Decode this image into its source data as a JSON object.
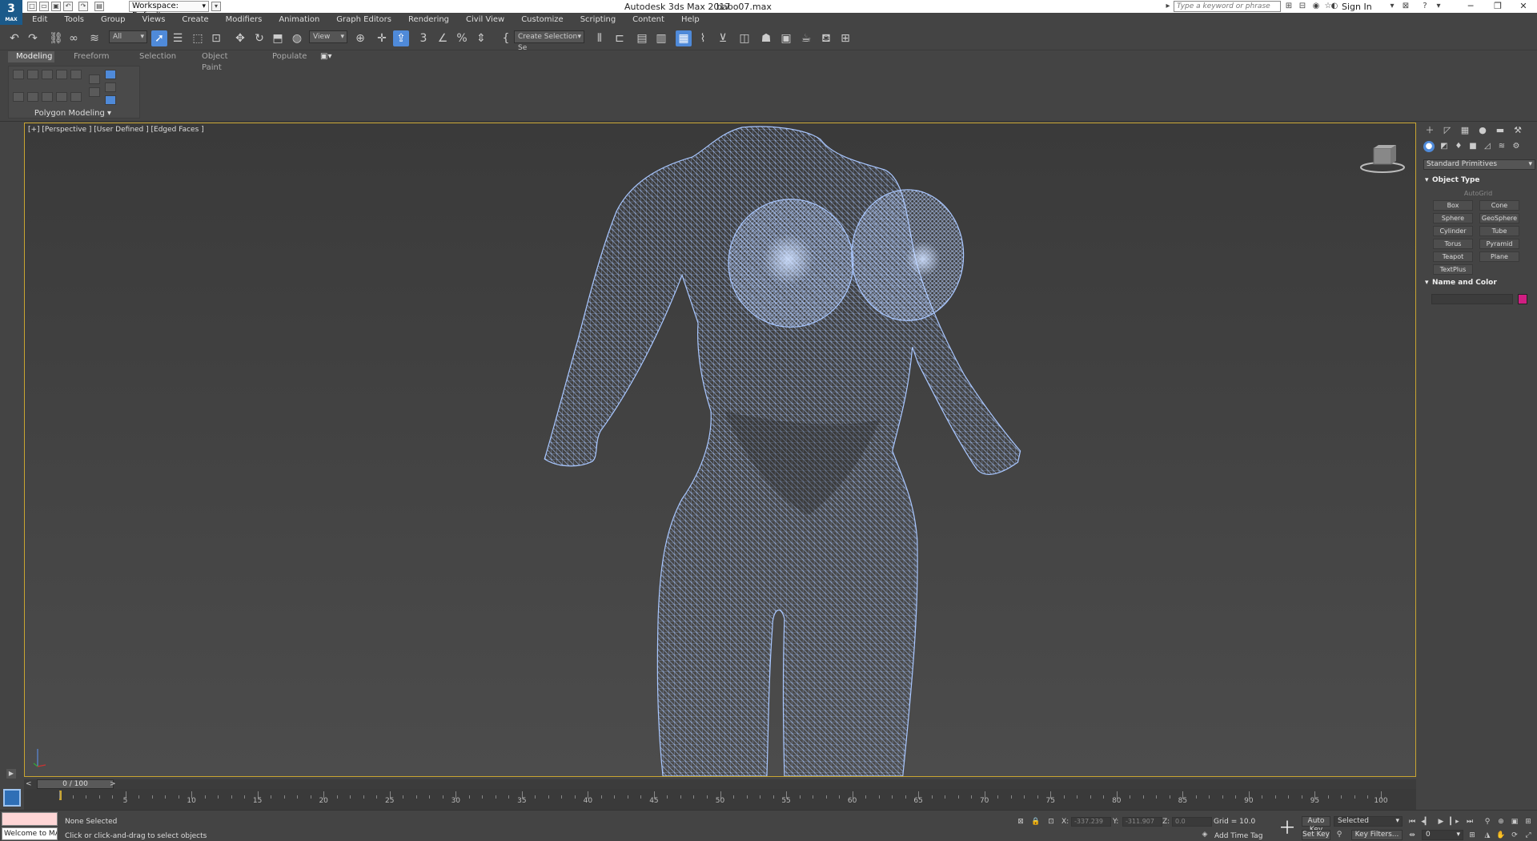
{
  "app": {
    "logo": "3",
    "logo_sub": "MAX",
    "title": "Autodesk 3ds Max 2017",
    "file": "babo07.max",
    "workspace": "Workspace: Default",
    "search_placeholder": "Type a keyword or phrase",
    "sign_in": "Sign In"
  },
  "menu": [
    "Edit",
    "Tools",
    "Group",
    "Views",
    "Create",
    "Modifiers",
    "Animation",
    "Graph Editors",
    "Rendering",
    "Civil View",
    "Customize",
    "Scripting",
    "Content",
    "Help"
  ],
  "toolbar": {
    "filter": "All",
    "ref_coord": "View",
    "selection_set": "Create Selection Se"
  },
  "ribbon": {
    "tabs": [
      "Modeling",
      "Freeform",
      "Selection",
      "Object Paint",
      "Populate"
    ],
    "active_tab": "Modeling",
    "panel_label": "Polygon Modeling"
  },
  "viewport": {
    "label": "[+] [Perspective ] [User Defined ] [Edged Faces ]"
  },
  "command_panel": {
    "category": "Standard Primitives",
    "object_type_title": "Object Type",
    "autogrid": "AutoGrid",
    "primitives": [
      "Box",
      "Cone",
      "Sphere",
      "GeoSphere",
      "Cylinder",
      "Tube",
      "Torus",
      "Pyramid",
      "Teapot",
      "Plane",
      "TextPlus"
    ],
    "name_color_title": "Name and Color",
    "object_color": "#d01e82"
  },
  "timeline": {
    "position": "0 / 100",
    "left_arrow": "<",
    "right_arrow": ">",
    "labels": [
      "0",
      "5",
      "10",
      "15",
      "20",
      "25",
      "30",
      "35",
      "40",
      "45",
      "50",
      "55",
      "60",
      "65",
      "70",
      "75",
      "80",
      "85",
      "90",
      "95",
      "100"
    ]
  },
  "status": {
    "listener": "Welcome to MA",
    "selection": "None Selected",
    "prompt": "Click or click-and-drag to select objects",
    "x_label": "X:",
    "x_value": "-337.239",
    "y_label": "Y:",
    "y_value": "-311.907",
    "z_label": "Z:",
    "z_value": "0.0",
    "grid": "Grid = 10.0",
    "add_time_tag": "Add Time Tag",
    "auto_key": "Auto Key",
    "set_key": "Set Key",
    "selected_dropdown": "Selected",
    "key_filters": "Key Filters...",
    "frame": "0"
  },
  "colors": {
    "viewport_border": "#c9a531",
    "active_blue": "#4f8ad9",
    "wire": "#a9c7ff"
  }
}
